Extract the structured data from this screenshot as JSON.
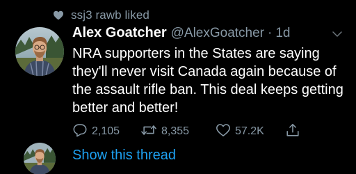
{
  "social_context": {
    "icon": "heart-icon",
    "text": "ssj3 rawb liked"
  },
  "tweet": {
    "author": {
      "display_name": "Alex Goatcher",
      "handle": "@AlexGoatcher",
      "separator": "·",
      "time": "1d"
    },
    "text": "NRA supporters in the States are saying they'll never visit Canada again because of the assault rifle ban. This deal keeps getting better and better!",
    "actions": {
      "reply_count": "2,105",
      "retweet_count": "8,355",
      "like_count": "57.2K"
    }
  },
  "thread_link": "Show this thread",
  "colors": {
    "background": "#000000",
    "text_primary": "#ffffff",
    "text_secondary": "#8899a6",
    "link": "#1da1f2"
  }
}
